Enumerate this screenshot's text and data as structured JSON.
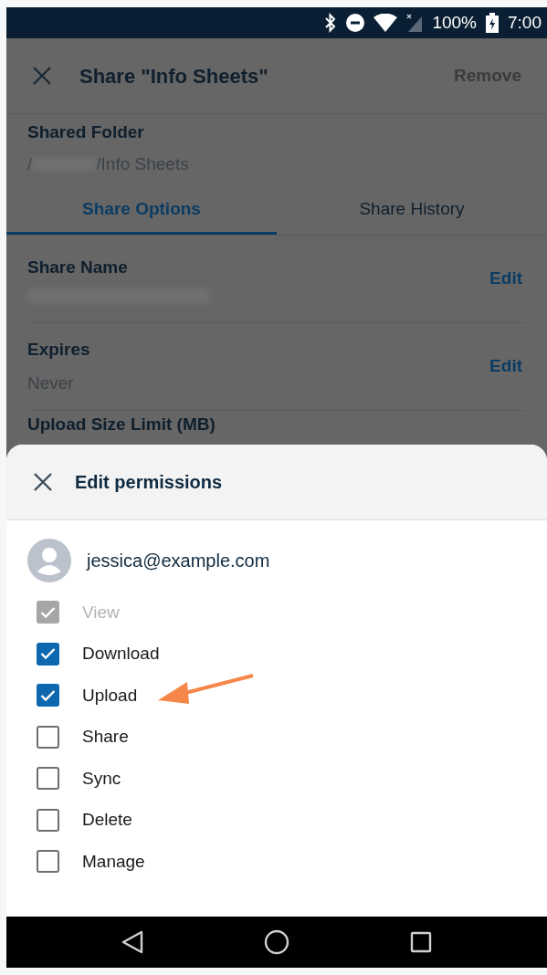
{
  "status_bar": {
    "battery": "100%",
    "time": "7:00"
  },
  "app_bar": {
    "title": "Share \"Info Sheets\"",
    "action": "Remove"
  },
  "shared_folder": {
    "label": "Shared Folder",
    "path_start": "/",
    "path_end": "/Info Sheets"
  },
  "tabs": [
    {
      "label": "Share Options",
      "selected": true
    },
    {
      "label": "Share History",
      "selected": false
    }
  ],
  "settings": [
    {
      "label": "Share Name",
      "action": "Edit"
    },
    {
      "label": "Expires",
      "value": "Never",
      "action": "Edit"
    },
    {
      "label": "Upload Size Limit (MB)"
    }
  ],
  "sheet": {
    "title": "Edit permissions",
    "user": "jessica@example.com",
    "permissions": [
      {
        "label": "View",
        "checked": true,
        "disabled": true
      },
      {
        "label": "Download",
        "checked": true,
        "disabled": false
      },
      {
        "label": "Upload",
        "checked": true,
        "disabled": false
      },
      {
        "label": "Share",
        "checked": false,
        "disabled": false
      },
      {
        "label": "Sync",
        "checked": false,
        "disabled": false
      },
      {
        "label": "Delete",
        "checked": false,
        "disabled": false
      },
      {
        "label": "Manage",
        "checked": false,
        "disabled": false
      }
    ]
  }
}
